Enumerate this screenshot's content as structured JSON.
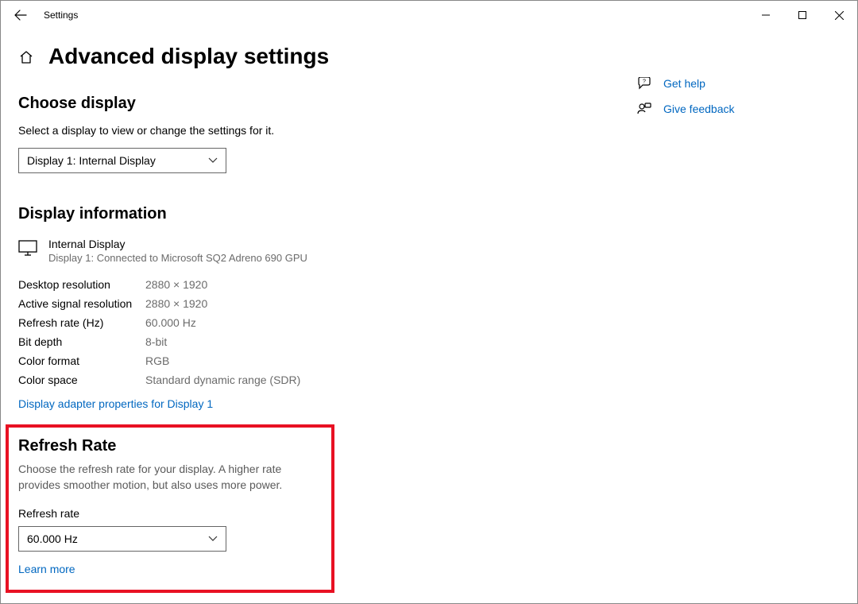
{
  "window": {
    "title": "Settings"
  },
  "page": {
    "heading": "Advanced display settings"
  },
  "choose": {
    "heading": "Choose display",
    "desc": "Select a display to view or change the settings for it.",
    "selected": "Display 1: Internal Display"
  },
  "info": {
    "heading": "Display information",
    "display_name": "Internal Display",
    "display_sub": "Display 1: Connected to Microsoft SQ2 Adreno 690 GPU",
    "rows": [
      {
        "label": "Desktop resolution",
        "value": "2880 × 1920"
      },
      {
        "label": "Active signal resolution",
        "value": "2880 × 1920"
      },
      {
        "label": "Refresh rate (Hz)",
        "value": "60.000 Hz"
      },
      {
        "label": "Bit depth",
        "value": "8-bit"
      },
      {
        "label": "Color format",
        "value": "RGB"
      },
      {
        "label": "Color space",
        "value": "Standard dynamic range (SDR)"
      }
    ],
    "adapter_link": "Display adapter properties for Display 1"
  },
  "refresh": {
    "heading": "Refresh Rate",
    "desc": "Choose the refresh rate for your display. A higher rate provides smoother motion, but also uses more power.",
    "label": "Refresh rate",
    "selected": "60.000 Hz",
    "learn": "Learn more"
  },
  "side": {
    "help": "Get help",
    "feedback": "Give feedback"
  }
}
